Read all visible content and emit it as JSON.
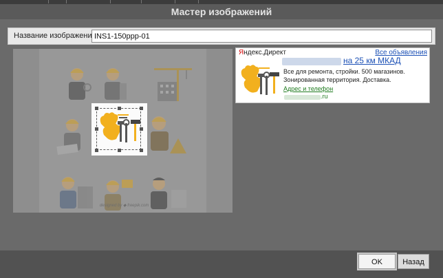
{
  "dialog": {
    "title": "Мастер изображений"
  },
  "name_field": {
    "label": "Название изображения",
    "value": "INS1-150ppp-01"
  },
  "preview": {
    "watermark": "designed by ◆ freepik.com"
  },
  "ad": {
    "brand_prefix": "Я",
    "brand_rest": "ндекс.Директ",
    "all_ads_link": "Все объявления",
    "headline": "на 25 км МКАД",
    "description": "Все для ремонта, стройки. 500 магазинов. Зонированная территория. Доставка.",
    "address_link": "Адрес и телефон",
    "domain_suffix": ".ru"
  },
  "buttons": {
    "ok": "OK",
    "back": "Назад"
  },
  "colors": {
    "link_blue": "#1a4fb5",
    "link_green": "#1e7a1e",
    "helmet_yellow": "#f2b01e"
  }
}
